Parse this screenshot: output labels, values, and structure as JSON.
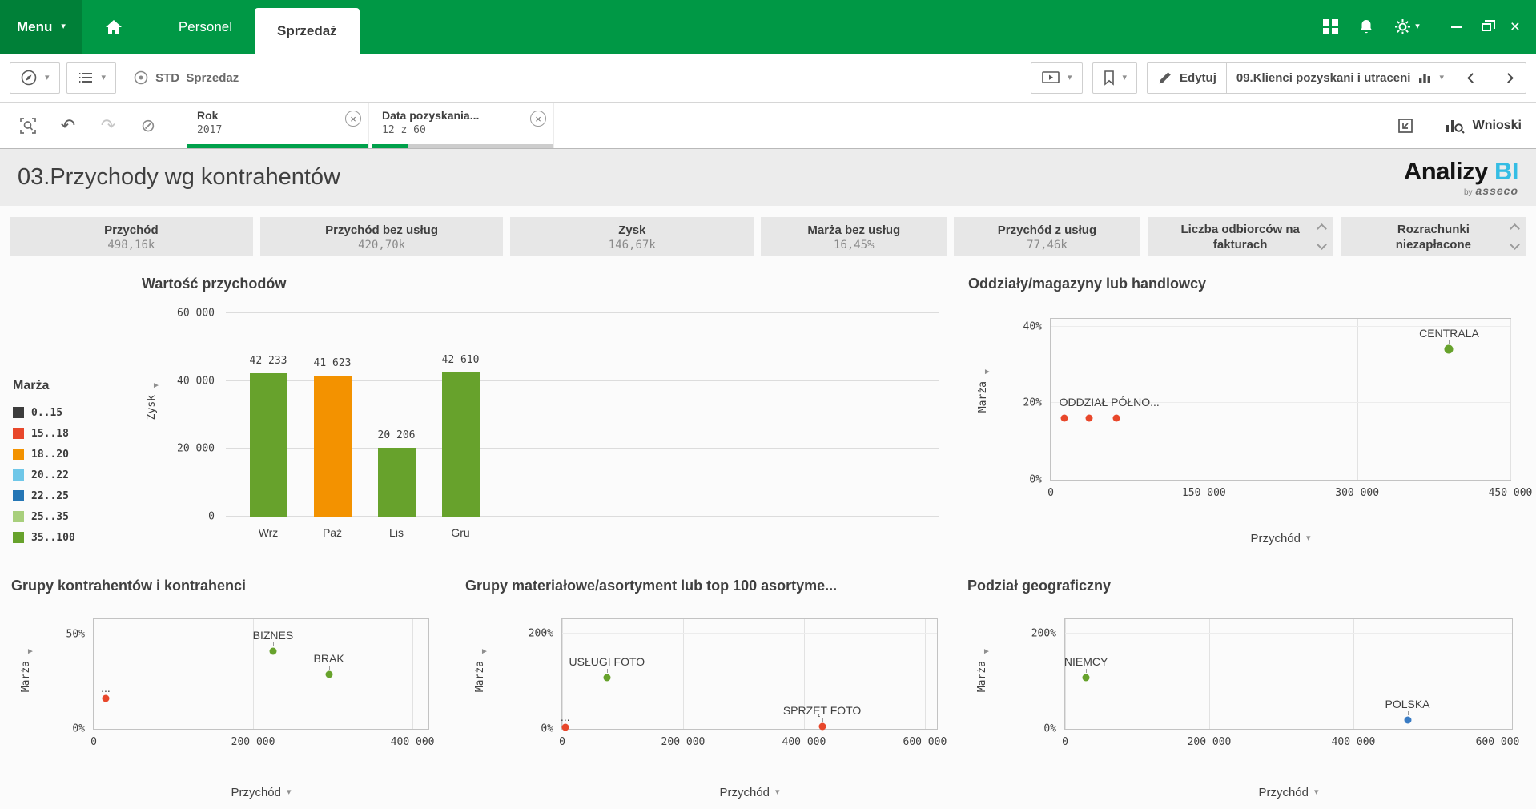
{
  "topbar": {
    "menu_label": "Menu",
    "tabs": [
      {
        "label": "Personel",
        "active": false
      },
      {
        "label": "Sprzedaż",
        "active": true
      }
    ]
  },
  "toolbar": {
    "app_name": "STD_Sprzedaz",
    "edit_label": "Edytuj",
    "sheet_title": "09.Klienci pozyskani i utraceni"
  },
  "selections_bar": {
    "filters": [
      {
        "field": "Rok",
        "value": "2017",
        "progress": 1
      },
      {
        "field": "Data pozyskania...",
        "value": "12 z 60",
        "progress": 0.2
      }
    ],
    "insights_label": "Wnioski"
  },
  "sheet_header": {
    "title": "03.Przychody wg kontrahentów",
    "logo_text": "Analizy",
    "logo_accent": "BI",
    "byline_pre": "by",
    "byline_brand": "asseco"
  },
  "kpis": [
    {
      "label": "Przychód",
      "value": "498,16k"
    },
    {
      "label": "Przychód bez usług",
      "value": "420,70k"
    },
    {
      "label": "Zysk",
      "value": "146,67k"
    },
    {
      "label": "Marża bez usług",
      "value": "16,45%"
    },
    {
      "label": "Przychód z usług",
      "value": "77,46k"
    },
    {
      "label": "Liczba odbiorców na fakturach",
      "scrollable": true
    },
    {
      "label": "Rozrachunki niezapłacone",
      "scrollable": true
    }
  ],
  "colors": {
    "topbar_green": "#009845",
    "accent_green": "#00a14b",
    "logo_blue": "#35bde4",
    "bar_green": "#67a22c",
    "bar_orange": "#f39200",
    "point_red": "#e8472b",
    "point_blue": "#3a7cc4"
  },
  "icons": {
    "caret_down": "▾",
    "scroll_right": "►",
    "undo": "↶",
    "redo": "↷",
    "clear_selections": "⊘",
    "chip_close": "×",
    "window_close": "×"
  },
  "chart_data": [
    {
      "type": "bar",
      "title": "Wartość przychodów",
      "ylabel": "Zysk",
      "legend_title": "Marża",
      "legend": [
        {
          "label": "0..15",
          "color": "#3c3c3c"
        },
        {
          "label": "15..18",
          "color": "#e8472b"
        },
        {
          "label": "18..20",
          "color": "#f39200"
        },
        {
          "label": "20..22",
          "color": "#6fc7e8"
        },
        {
          "label": "22..25",
          "color": "#2576b5"
        },
        {
          "label": "25..35",
          "color": "#a8cf7c"
        },
        {
          "label": "35..100",
          "color": "#67a22c"
        }
      ],
      "categories": [
        "Wrz",
        "Paź",
        "Lis",
        "Gru"
      ],
      "values": [
        42233,
        41623,
        20206,
        42610
      ],
      "value_labels": [
        "42 233",
        "41 623",
        "20 206",
        "42 610"
      ],
      "bar_colors": [
        "#67a22c",
        "#f39200",
        "#67a22c",
        "#67a22c"
      ],
      "ylim": [
        0,
        60000
      ],
      "yticks": [
        {
          "v": 0,
          "label": "0"
        },
        {
          "v": 20000,
          "label": "20 000"
        },
        {
          "v": 40000,
          "label": "40 000"
        },
        {
          "v": 60000,
          "label": "60 000"
        }
      ]
    },
    {
      "type": "scatter",
      "title": "Oddziały/magazyny lub handlowcy",
      "ylabel": "Marża",
      "xlabel": "Przychód",
      "xlim": [
        0,
        450000
      ],
      "ylim": [
        0,
        42
      ],
      "xticks": [
        {
          "v": 0,
          "label": "0"
        },
        {
          "v": 150000,
          "label": "150 000"
        },
        {
          "v": 300000,
          "label": "300 000"
        },
        {
          "v": 450000,
          "label": "450 000"
        }
      ],
      "yticks": [
        {
          "v": 0,
          "label": "0%"
        },
        {
          "v": 20,
          "label": "20%"
        },
        {
          "v": 40,
          "label": "40%"
        }
      ],
      "points": [
        {
          "x": 390000,
          "y": 34,
          "color": "#67a22c",
          "label": "CENTRALA",
          "size": 11
        },
        {
          "x": 13000,
          "y": 16,
          "color": "#e8472b",
          "label": "ODDZIAŁ PÓŁNO...",
          "align": "left"
        },
        {
          "x": 38000,
          "y": 16,
          "color": "#e8472b"
        },
        {
          "x": 64000,
          "y": 16,
          "color": "#e8472b"
        }
      ]
    },
    {
      "type": "scatter",
      "title": "Grupy kontrahentów i kontrahenci",
      "ylabel": "Marża",
      "xlabel": "Przychód",
      "xlim": [
        0,
        420000
      ],
      "ylim": [
        0,
        58
      ],
      "xticks": [
        {
          "v": 0,
          "label": "0"
        },
        {
          "v": 200000,
          "label": "200 000"
        },
        {
          "v": 400000,
          "label": "400 000"
        }
      ],
      "yticks": [
        {
          "v": 0,
          "label": "0%"
        },
        {
          "v": 50,
          "label": "50%"
        }
      ],
      "points": [
        {
          "x": 15000,
          "y": 16,
          "color": "#e8472b",
          "label": "..."
        },
        {
          "x": 225000,
          "y": 41,
          "color": "#67a22c",
          "label": "BIZNES"
        },
        {
          "x": 295000,
          "y": 29,
          "color": "#67a22c",
          "label": "BRAK"
        }
      ]
    },
    {
      "type": "scatter",
      "title": "Grupy materiałowe/asortyment lub top 100 asortyme...",
      "ylabel": "Marża",
      "xlabel": "Przychód",
      "xlim": [
        0,
        620000
      ],
      "ylim": [
        0,
        230
      ],
      "xticks": [
        {
          "v": 0,
          "label": "0"
        },
        {
          "v": 200000,
          "label": "200 000"
        },
        {
          "v": 400000,
          "label": "400 000"
        },
        {
          "v": 600000,
          "label": "600 000"
        }
      ],
      "yticks": [
        {
          "v": 0,
          "label": "0%"
        },
        {
          "v": 200,
          "label": "200%"
        }
      ],
      "points": [
        {
          "x": 5000,
          "y": 3,
          "color": "#e8472b",
          "label": "..."
        },
        {
          "x": 74000,
          "y": 108,
          "color": "#67a22c",
          "label": "USŁUGI FOTO"
        },
        {
          "x": 430000,
          "y": 5,
          "color": "#e8472b",
          "label": "SPRZĘT FOTO"
        }
      ]
    },
    {
      "type": "scatter",
      "title": "Podział geograficzny",
      "ylabel": "Marża",
      "xlabel": "Przychód",
      "xlim": [
        0,
        620000
      ],
      "ylim": [
        0,
        230
      ],
      "xticks": [
        {
          "v": 0,
          "label": "0"
        },
        {
          "v": 200000,
          "label": "200 000"
        },
        {
          "v": 400000,
          "label": "400 000"
        },
        {
          "v": 600000,
          "label": "600 000"
        }
      ],
      "yticks": [
        {
          "v": 0,
          "label": "0%"
        },
        {
          "v": 200,
          "label": "200%"
        }
      ],
      "points": [
        {
          "x": 29000,
          "y": 108,
          "color": "#67a22c",
          "label": "NIEMCY"
        },
        {
          "x": 475000,
          "y": 18,
          "color": "#3a7cc4",
          "label": "POLSKA"
        }
      ]
    }
  ]
}
